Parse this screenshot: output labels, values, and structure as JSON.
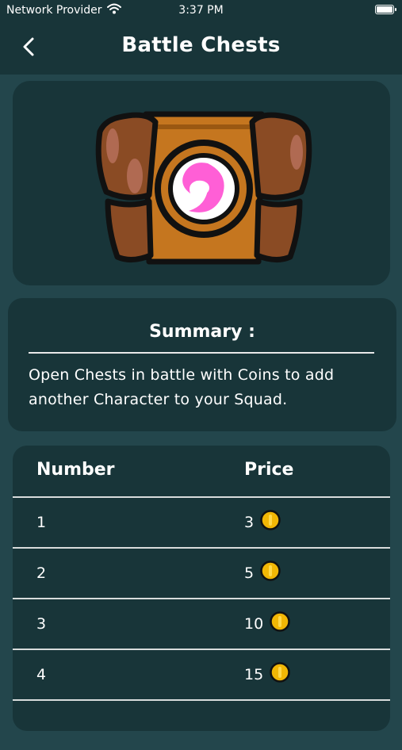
{
  "status_bar": {
    "carrier": "Network Provider",
    "time": "3:37 PM",
    "icons": [
      "wifi-icon",
      "battery-icon"
    ]
  },
  "nav": {
    "back_icon": "chevron-left-icon",
    "title": "Battle Chests"
  },
  "hero": {
    "image": "treasure-chest-icon"
  },
  "summary": {
    "heading": "Summary :",
    "line1": "Open Chests in battle with Coins to add",
    "line2": "another Character to your Squad."
  },
  "table": {
    "headers": {
      "number": "Number",
      "price": "Price"
    },
    "coin_icon": "coin-icon",
    "rows": [
      {
        "number": "1",
        "price": "3"
      },
      {
        "number": "2",
        "price": "5"
      },
      {
        "number": "3",
        "price": "10"
      },
      {
        "number": "4",
        "price": "15"
      }
    ]
  },
  "colors": {
    "background": "#23464c",
    "card": "#183539",
    "text": "#ffffff",
    "coin": "#f2b705"
  }
}
